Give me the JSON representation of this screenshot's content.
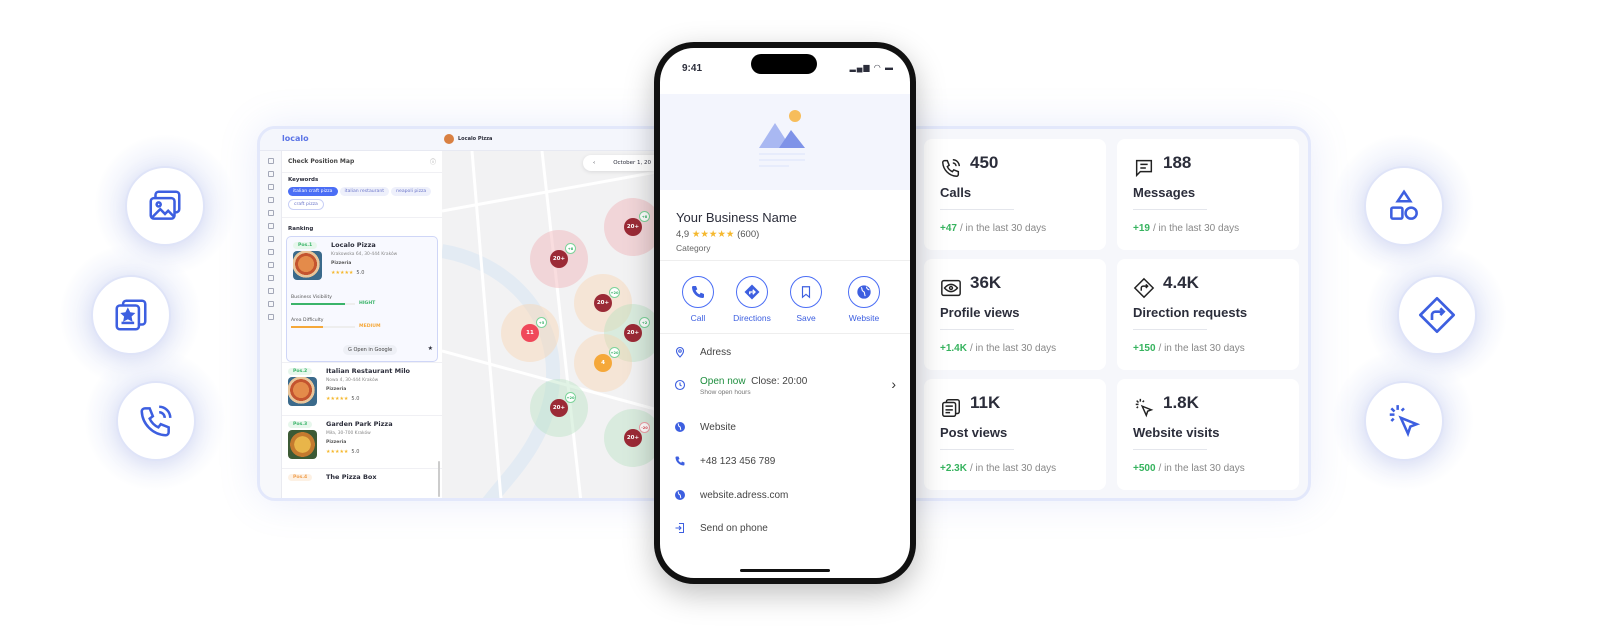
{
  "floating_icons_left": [
    "images-icon",
    "starred-document-icon",
    "phone-call-icon"
  ],
  "floating_icons_right": [
    "shapes-icon",
    "direction-sign-icon",
    "click-cursor-icon"
  ],
  "dashboard": {
    "logo": "localo",
    "business": "Localo Pizza",
    "panel_title": "Check Position Map",
    "keywords_label": "Keywords",
    "keywords": [
      {
        "label": "italian craft pizza",
        "active": true
      },
      {
        "label": "italian restaurant"
      },
      {
        "label": "neapoli pizza"
      },
      {
        "label": "craft pizza"
      }
    ],
    "ranking_label": "Ranking",
    "rankings": [
      {
        "pos": "Pos.1",
        "name": "Localo Pizza",
        "address": "Krakowska 64, 30-444 Kraków",
        "category": "Pizzeria",
        "stars": "★★★★★",
        "rating": "5.0"
      },
      {
        "pos": "Pos.2",
        "name": "Italian Restaurant Milo",
        "address": "Nowa 4, 30-444 Kraków",
        "category": "Pizzeria",
        "stars": "★★★★★",
        "rating": "5.0"
      },
      {
        "pos": "Pos.3",
        "name": "Garden Park Pizza",
        "address": "Miła, 30-700 Kraków",
        "category": "Pizzeria",
        "stars": "★★★★★",
        "rating": "5.0"
      },
      {
        "pos": "Pos.4",
        "name": "The Pizza Box"
      }
    ],
    "visibility_label": "Business Visibility",
    "visibility_value": "HIGHT",
    "visibility_level": 0.85,
    "difficulty_label": "Area Difficulty",
    "difficulty_value": "MEDIUM",
    "difficulty_level": 0.5,
    "open_google": "Open in Google",
    "date": "October 1, 20",
    "date_prev": "‹",
    "pins": [
      {
        "v": "20+",
        "d": "+8",
        "color": "#9b2a36"
      },
      {
        "v": "20+",
        "d": "+8",
        "color": "#9b2a36"
      },
      {
        "v": "20+",
        "d": "+20",
        "color": "#9b2a36"
      },
      {
        "v": "11",
        "d": "+5",
        "color": "#f0485a"
      },
      {
        "v": "20+",
        "d": "+2",
        "color": "#9b2a36"
      },
      {
        "v": "4",
        "d": "+20",
        "color": "#f5a83a"
      },
      {
        "v": "20+",
        "d": "+20",
        "color": "#9b2a36"
      },
      {
        "v": "20+",
        "d": "-20",
        "color": "#9b2a36"
      }
    ]
  },
  "phone": {
    "time": "9:41",
    "business_name": "Your Business Name",
    "rating": "4,9",
    "stars": "★★★★★",
    "reviews": "(600)",
    "category": "Category",
    "actions": [
      "Call",
      "Directions",
      "Save",
      "Website"
    ],
    "address": "Adress",
    "open_now": "Open now",
    "close": "Close: 20:00",
    "show_hours": "Show open hours",
    "website": "Website",
    "phone_number": "+48 123 456 789",
    "url": "website.adress.com",
    "send": "Send on phone"
  },
  "stats": [
    {
      "icon": "phone-icon",
      "value": "450",
      "label": "Calls",
      "change": "+47",
      "period": "/ in the last 30 days"
    },
    {
      "icon": "message-icon",
      "value": "188",
      "label": "Messages",
      "change": "+19",
      "period": "/ in the last 30 days"
    },
    {
      "icon": "eye-icon",
      "value": "36K",
      "label": "Profile views",
      "change": "+1.4K",
      "period": "/ in the last 30 days"
    },
    {
      "icon": "direction-icon",
      "value": "4.4K",
      "label": "Direction requests",
      "change": "+150",
      "period": "/ in the last 30 days"
    },
    {
      "icon": "post-icon",
      "value": "11K",
      "label": "Post views",
      "change": "+2.3K",
      "period": "/ in the last 30 days"
    },
    {
      "icon": "click-icon",
      "value": "1.8K",
      "label": "Website visits",
      "change": "+500",
      "period": "/ in the last 30 days"
    }
  ],
  "colors": {
    "accent": "#4b6ef5",
    "positive": "#36b35e",
    "open": "#1e8e3e",
    "star": "#f5b82e"
  }
}
